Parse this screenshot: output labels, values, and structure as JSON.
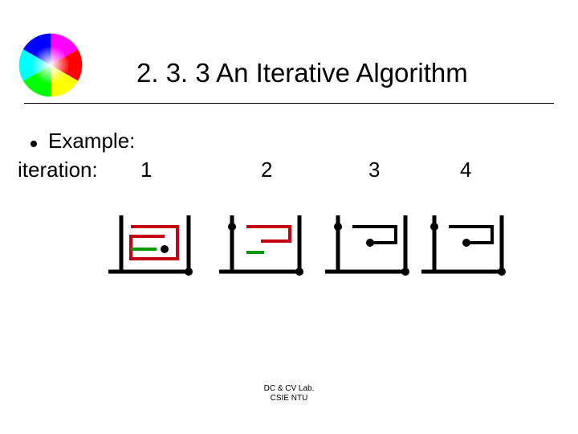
{
  "title": "2. 3. 3 An Iterative Algorithm",
  "bullet": "Example:",
  "iteration_label": "iteration:",
  "numbers": {
    "n1": "1",
    "n2": "2",
    "n3": "3",
    "n4": "4"
  },
  "footer_line1": "DC & CV Lab.",
  "footer_line2": "CSIE NTU"
}
